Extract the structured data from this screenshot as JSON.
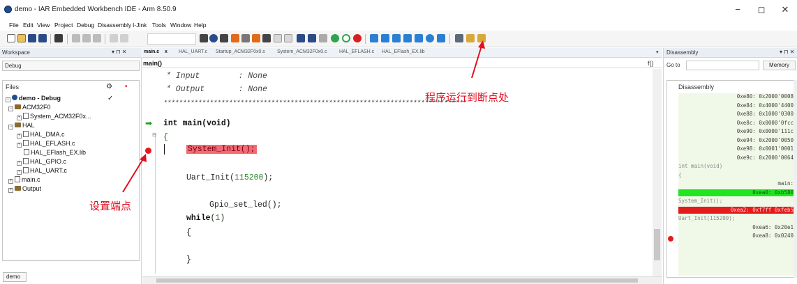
{
  "window": {
    "title": "demo - IAR Embedded Workbench IDE - Arm 8.50.9",
    "minimize": "−",
    "maximize": "◻",
    "close": "✕"
  },
  "menu": [
    "File",
    "Edit",
    "View",
    "Project",
    "Debug",
    "Disassembly",
    "I-Jink",
    "Tools",
    "Window",
    "Help"
  ],
  "toolbar": {
    "icons": [
      "new-file-icon",
      "open-icon",
      "save-icon",
      "save-all-icon",
      "print-icon",
      "cut-icon",
      "copy-icon",
      "paste-icon",
      "undo-icon",
      "redo-icon",
      "find-icon",
      "search-prev-icon",
      "search-icon",
      "search-next-icon",
      "replace-icon",
      "nav-back-icon",
      "bookmark-icon",
      "nav-forward-icon",
      "toggle-bookmark-icon",
      "toggle-bookmark2-icon",
      "compile-icon",
      "make-icon",
      "stop-build-icon",
      "debug-icon",
      "debug-no-download-icon",
      "stop-debug-icon",
      "step-over-icon",
      "step-into-icon",
      "step-out-icon",
      "next-statement-icon",
      "run-to-cursor-icon",
      "go-icon",
      "break-icon",
      "reset-icon",
      "toggle-breakpoint-icon",
      "breakpoint-icon"
    ]
  },
  "workspace": {
    "title": "Workspace",
    "pin": "▾ ⊓ ✕",
    "config": "Debug",
    "files_label": "Files",
    "tree": [
      {
        "label": "demo - Debug",
        "bold": true,
        "check": "✓"
      },
      {
        "label": "ACM32F0"
      },
      {
        "label": "System_ACM32F0x..."
      },
      {
        "label": "HAL"
      },
      {
        "label": "HAL_DMA.c"
      },
      {
        "label": "HAL_EFLASH.c"
      },
      {
        "label": "HAL_EFlash_EX.lib"
      },
      {
        "label": "HAL_GPIO.c"
      },
      {
        "label": "HAL_UART.c"
      },
      {
        "label": "main.c"
      },
      {
        "label": "Output"
      }
    ],
    "tab": "demo"
  },
  "editor": {
    "tabs": [
      "main.c",
      "HAL_UART.c",
      "Startup_ACM32F0x0.s",
      "System_ACM32F0x0.c",
      "HAL_EFLASH.c",
      "HAL_EFlash_EX.lib"
    ],
    "tab_close": "x",
    "function": "main()",
    "fx": "f()",
    "code": [
      {
        "cls": "cmt",
        "text": "* Input        : None"
      },
      {
        "cls": "cmt",
        "text": "* Output       : None"
      },
      {
        "cls": "cmt",
        "text": "*******************************************************************************"
      },
      {
        "cls": "kw",
        "text": "int main(void)"
      },
      {
        "cls": "",
        "text": "{"
      },
      {
        "cls": "",
        "text": "System_Init();"
      },
      {
        "cls": "",
        "text": "Uart_Init(115200);"
      },
      {
        "cls": "",
        "text": "Gpio_set_led();"
      },
      {
        "cls": "",
        "text": "while(1)"
      },
      {
        "cls": "",
        "text": "{"
      },
      {
        "cls": "",
        "text": "}"
      }
    ]
  },
  "disassembly": {
    "title": "Disassembly",
    "pin": "▾ ⊓ ✕",
    "goto": "Go to",
    "memory": "Memory",
    "label": "Disassembly",
    "lines": [
      {
        "t": "0xe80: 0x2000'0008",
        "c": "addr"
      },
      {
        "t": "0xe84: 0x4000'4400",
        "c": "addr"
      },
      {
        "t": "0xe88: 0x1000'0300",
        "c": "addr"
      },
      {
        "t": "0xe8c: 0x0000'0fcc",
        "c": "addr"
      },
      {
        "t": "0xe90: 0x0000'111c",
        "c": "addr"
      },
      {
        "t": "0xe94: 0x2000'0050",
        "c": "addr"
      },
      {
        "t": "0xe98: 0x0001'0001",
        "c": "addr"
      },
      {
        "t": "0xe9c: 0x2000'0064",
        "c": "addr"
      },
      {
        "t": "int main(void)",
        "c": "src"
      },
      {
        "t": "{",
        "c": "src"
      },
      {
        "t": "main:",
        "c": "addr"
      },
      {
        "t": "0xea0: 0xb580",
        "c": "green"
      },
      {
        "t": "System_Init();",
        "c": "src"
      },
      {
        "t": "0xea2: 0xf7ff 0xfeb5",
        "c": "red"
      },
      {
        "t": "Uart_Init(115200);",
        "c": "src"
      },
      {
        "t": "0xea6: 0x20e1",
        "c": "addr"
      },
      {
        "t": "0xea8: 0x0240",
        "c": "addr"
      }
    ]
  },
  "annotations": {
    "breakpoint_note": "设置端点",
    "run_note": "程序运行到断点处"
  },
  "colors": {
    "annotation": "#e01020",
    "breakpoint": "#e41b1b",
    "current_line": "#22e522",
    "highlight": "#f26b74"
  }
}
